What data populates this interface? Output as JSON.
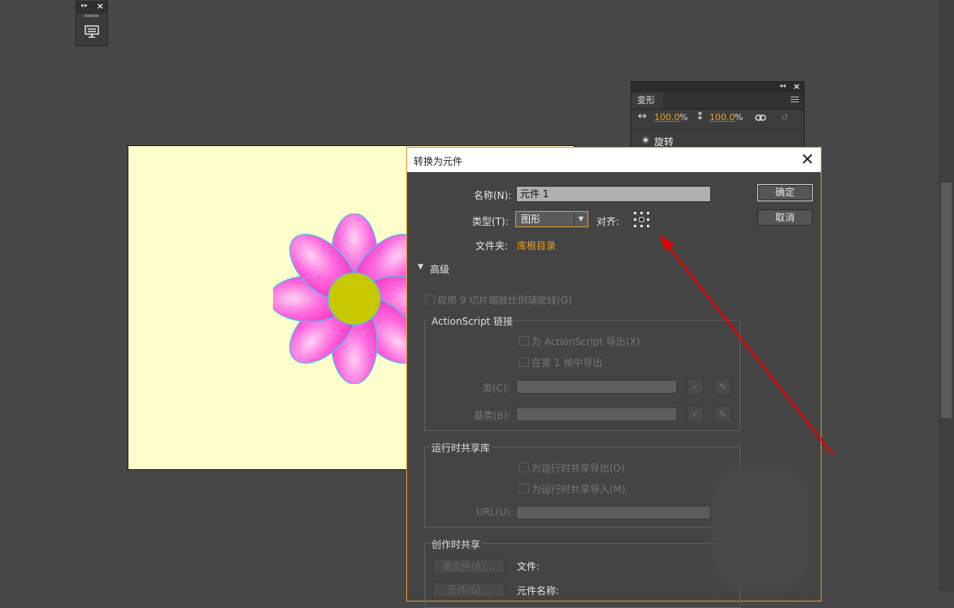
{
  "transform_panel": {
    "tab_label": "变形",
    "width_value": "100.0",
    "height_value": "100.0",
    "percent_unit": "%",
    "rotate_label": "旋转"
  },
  "dialog": {
    "title": "转换为元件",
    "name_label": "名称(N):",
    "name_value": "元件 1",
    "type_label": "类型(T):",
    "type_value": "图形",
    "align_label": "对齐:",
    "folder_label": "文件夹:",
    "folder_value": "库根目录",
    "ok_button": "确定",
    "cancel_button": "取消",
    "advanced_label": "高级",
    "scale9_label": "启用 9 切片缩放比例辅助线(G)",
    "actionscript_group": {
      "title": "ActionScript 链接",
      "export_as": "为 ActionScript 导出(X)",
      "export_frame1": "在第 1 帧中导出",
      "class_label": "类(C):",
      "base_class_label": "基类(B):"
    },
    "runtime_group": {
      "title": "运行时共享库",
      "export_runtime": "为运行时共享导出(O)",
      "import_runtime": "为运行时共享导入(M)",
      "url_label": "URL(U):"
    },
    "authoring_group": {
      "title": "创作时共享",
      "source_file_button": "源文件(R)...",
      "file_label": "文件:",
      "symbol_button": "元件(S)...",
      "symbol_name_label": "元件名称:"
    }
  },
  "colors": {
    "stage_bg": "#ffffcc",
    "petal": "#ff44cc",
    "center": "#c8c800",
    "accent": "#e59a2b",
    "annotation": "#e00000"
  }
}
